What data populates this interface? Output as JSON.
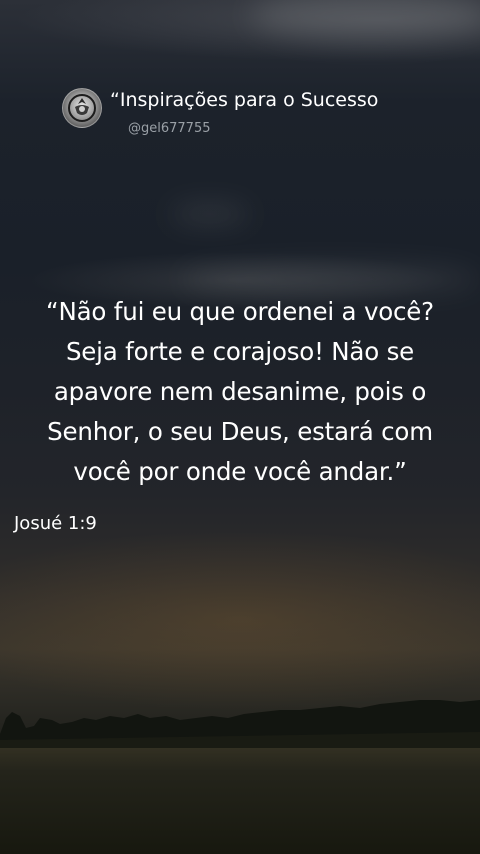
{
  "post": {
    "title": "“Inspirações para o Sucesso",
    "handle": "@gel677755",
    "avatar_icon": "emblem-logo-icon",
    "quote_lines": [
      "“Não fui eu que ordenei a você?",
      "Seja forte e corajoso! Não se",
      "apavore nem desanime, pois o",
      "Senhor, o seu Deus, estará com",
      "você por onde você andar.”"
    ],
    "reference": "Josué 1:9"
  },
  "colors": {
    "text": "#ffffff",
    "handle": "#9aa0a6",
    "sky": "#1a2029",
    "field": "#17180f"
  }
}
